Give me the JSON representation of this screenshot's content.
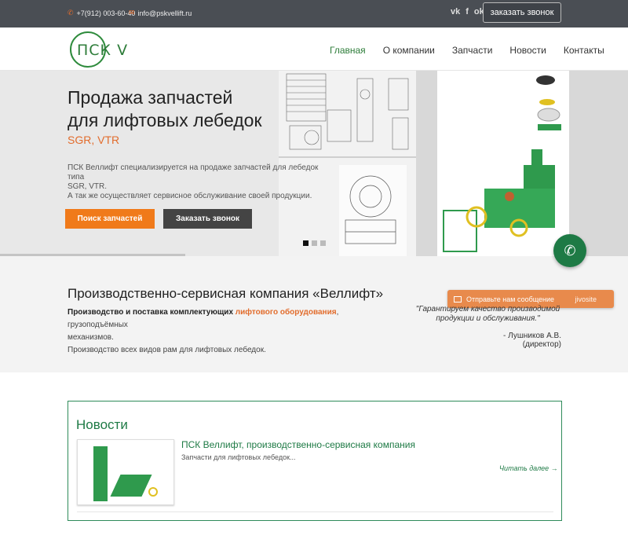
{
  "topbar": {
    "phone": "+7(912) 003-60-40",
    "email": "info@pskvellift.ru",
    "social": [
      "vk-icon",
      "facebook-icon",
      "odnoklassniki-icon"
    ],
    "social_glyphs": [
      "vk",
      "f",
      "ok"
    ],
    "call_button": "заказать звонок"
  },
  "header": {
    "logo": "ПСК V",
    "nav": [
      {
        "label": "Главная",
        "active": true
      },
      {
        "label": "О компании",
        "active": false
      },
      {
        "label": "Запчасти",
        "active": false
      },
      {
        "label": "Новости",
        "active": false
      },
      {
        "label": "Контакты",
        "active": false
      }
    ]
  },
  "hero": {
    "title_line1": "Продажа запчастей",
    "title_line2": "для лифтовых лебедок",
    "subtitle": "SGR, VTR",
    "desc_line1": "ПСК Веллифт специализируется на продаже запчастей для лебедок типа",
    "desc_line2": "SGR, VTR.",
    "desc_line3": "А так же осуществляет сервисное обслуживание своей продукции.",
    "primary_button": "Поиск запчастей",
    "secondary_button": "Заказать звонок",
    "slides": 3,
    "active_slide": 1
  },
  "about": {
    "title": "Производственно-сервисная компания «Веллифт»",
    "line1_bold": "Производство и поставка комплектующих",
    "line1_highlight": "лифтового оборудования",
    "line1_rest": ", грузоподъёмных",
    "line2": "механизмов.",
    "line3": "Производство всех видов рам для лифтовых лебедок.",
    "quote": "\"Гарантируем качество производимой продукции и обслуживания.\"",
    "quote_author": "- Лушников А.В. (директор)"
  },
  "chat": {
    "message_label": "Отправьте нам сообщение",
    "brand": "jivosite"
  },
  "news": {
    "title": "Новости",
    "items": [
      {
        "headline": "ПСК Веллифт, производственно-сервисная компания",
        "excerpt": "Запчасти для лифтовых лебедок...",
        "read_more": "Читать далее →"
      }
    ]
  },
  "colors": {
    "accent_green": "#1e7a45",
    "accent_orange": "#f07a1a",
    "topbar_bg": "#4a4e54"
  }
}
